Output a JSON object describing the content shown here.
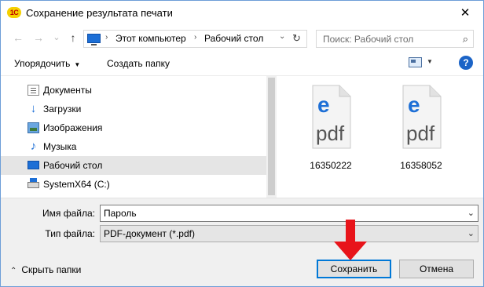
{
  "window": {
    "app_logo": "1С",
    "title": "Сохранение результата печати",
    "close_glyph": "✕"
  },
  "nav": {
    "back_icon": "←",
    "forward_icon": "→",
    "recent_icon": "⌄",
    "up_icon": "↑",
    "address": {
      "sep1": "›",
      "segment1": "Этот компьютер",
      "sep2": "›",
      "segment2": "Рабочий стол",
      "dropdown_icon": "⌄",
      "refresh_icon": "↻"
    },
    "search": {
      "placeholder": "Поиск: Рабочий стол",
      "icon": "⌕"
    }
  },
  "toolbar": {
    "organize_label": "Упорядочить",
    "organize_arrow": "▼",
    "new_folder_label": "Создать папку",
    "view_dropdown": "▼",
    "help_label": "?"
  },
  "sidebar": {
    "items": [
      {
        "label": "Документы",
        "icon": "documents-icon"
      },
      {
        "label": "Загрузки",
        "icon": "downloads-icon"
      },
      {
        "label": "Изображения",
        "icon": "pictures-icon"
      },
      {
        "label": "Музыка",
        "icon": "music-icon"
      },
      {
        "label": "Рабочий стол",
        "icon": "desktop-icon",
        "selected": true
      },
      {
        "label": "SystemX64 (C:)",
        "icon": "drive-icon"
      }
    ],
    "download_glyph": "↓",
    "music_glyph": "♪"
  },
  "files": [
    {
      "name": "16350222",
      "icon_letter": "e",
      "icon_text": "pdf"
    },
    {
      "name": "16358052",
      "icon_letter": "e",
      "icon_text": "pdf"
    }
  ],
  "form": {
    "filename_label": "Имя файла:",
    "filename_value": "Пароль",
    "filetype_label": "Тип файла:",
    "filetype_value": "PDF-документ (*.pdf)",
    "chevron": "⌄"
  },
  "footer": {
    "hide_folders_chevron": "⌃",
    "hide_folders_label": "Скрыть папки",
    "save_label": "Сохранить",
    "cancel_label": "Отмена"
  },
  "colors": {
    "accent": "#0078d7",
    "edge_blue": "#1d6fd6",
    "arrow_red": "#e8141a",
    "selected_row": "#e5e5e5"
  }
}
